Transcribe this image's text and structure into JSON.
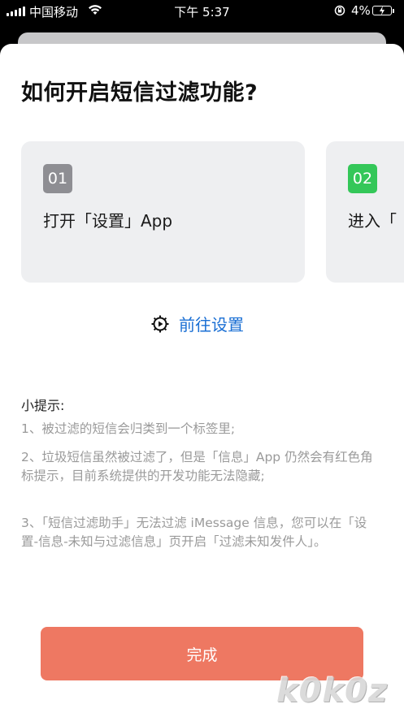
{
  "status_bar": {
    "carrier": "中国移动",
    "time": "下午 5:37",
    "battery": "4%"
  },
  "sheet": {
    "title": "如何开启短信过滤功能?",
    "steps": [
      {
        "number": "01",
        "text": "打开「设置」App",
        "color": "#8e8e93"
      },
      {
        "number": "02",
        "text": "进入「",
        "color": "#34c759"
      }
    ],
    "settings_link": "前往设置",
    "tips_title": "小提示:",
    "tips": [
      "1、被过滤的短信会归类到一个标签里;",
      "2、垃圾短信虽然被过滤了，但是「信息」App 仍然会有红色角标提示，目前系统提供的开发功能无法隐藏;",
      "3、「短信过滤助手」无法过滤 iMessage 信息，您可以在「设置-信息-未知与过滤信息」页开启「过滤未知发件人」。"
    ],
    "done_button": "完成"
  },
  "watermark": "k0k0z",
  "colors": {
    "accent_link": "#1a6fd4",
    "done_button": "#ee7862",
    "step_card": "#eeeff1"
  }
}
